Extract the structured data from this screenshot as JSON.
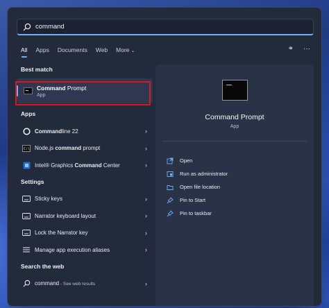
{
  "search": {
    "value": "command"
  },
  "tabs": [
    {
      "label": "All"
    },
    {
      "label": "Apps"
    },
    {
      "label": "Documents"
    },
    {
      "label": "Web"
    },
    {
      "label": "More"
    }
  ],
  "more_chevron": "⌄",
  "top_icons": {
    "share": "⚭",
    "more": "···"
  },
  "best_match": {
    "title": "Best match",
    "name_bold": "Command",
    "name_rest": " Prompt",
    "sub": "App",
    "highlight_color": "#d8191c"
  },
  "apps": {
    "title": "Apps",
    "items": [
      {
        "bold": "Command",
        "rest": "line 22",
        "prefix": ""
      },
      {
        "prefix": "Node.js ",
        "bold": "command",
        "rest": " prompt"
      },
      {
        "prefix": "Intel® Graphics ",
        "bold": "Command",
        "rest": " Center"
      }
    ]
  },
  "settings": {
    "title": "Settings",
    "items": [
      {
        "label": "Sticky keys"
      },
      {
        "label": "Narrator keyboard layout"
      },
      {
        "label": "Lock the Narrator key"
      },
      {
        "label": "Manage app execution aliases"
      }
    ]
  },
  "web": {
    "title": "Search the web",
    "query": "command",
    "suffix": " - See web results"
  },
  "preview": {
    "title": "Command Prompt",
    "sub": "App",
    "actions": [
      {
        "label": "Open",
        "icon": "open-icon"
      },
      {
        "label": "Run as administrator",
        "icon": "admin-shield-icon"
      },
      {
        "label": "Open file location",
        "icon": "folder-icon"
      },
      {
        "label": "Pin to Start",
        "icon": "pin-icon"
      },
      {
        "label": "Pin to taskbar",
        "icon": "pin-icon"
      }
    ]
  },
  "arrow_glyph": "›",
  "accent_color": "#6cb4ff"
}
